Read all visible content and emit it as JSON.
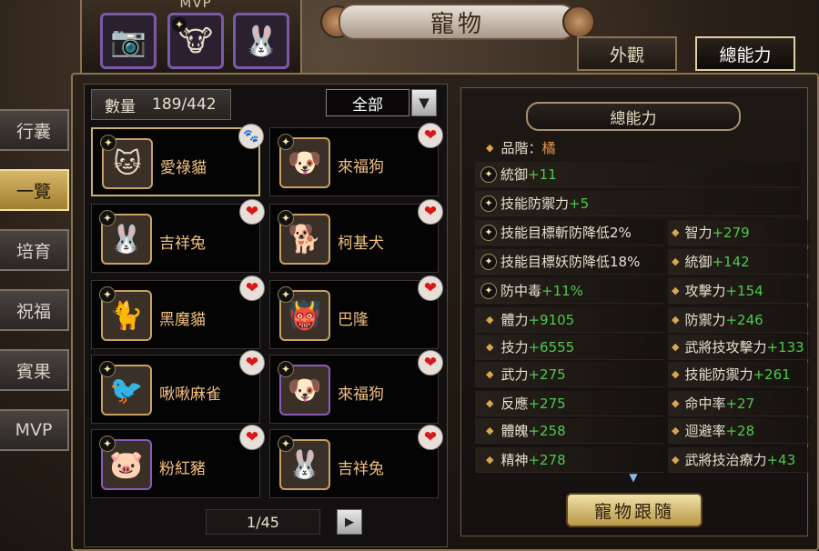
{
  "mvp": {
    "label": "MVP",
    "slots": [
      {
        "icon": "camera-pet-icon",
        "glyph": "📷"
      },
      {
        "icon": "bull-pet-icon",
        "glyph": "🐮"
      },
      {
        "icon": "rabbit-pet-icon",
        "glyph": "🐰"
      }
    ]
  },
  "title": "寵物",
  "top_tabs": [
    {
      "label": "外觀",
      "active": false
    },
    {
      "label": "總能力",
      "active": true
    }
  ],
  "nav": [
    {
      "label": "行囊",
      "active": false
    },
    {
      "label": "一覽",
      "active": true
    },
    {
      "label": "培育",
      "active": false
    },
    {
      "label": "祝福",
      "active": false
    },
    {
      "label": "賓果",
      "active": false
    },
    {
      "label": "MVP",
      "active": false
    }
  ],
  "list": {
    "count_label": "數量",
    "count_value": "189/442",
    "filter": "全部",
    "page": "1/45",
    "pets": [
      {
        "name": "愛祿貓",
        "glyph": "🐱",
        "badge": "paw",
        "selected": true,
        "frame": "gold"
      },
      {
        "name": "來福狗",
        "glyph": "🐶",
        "badge": "heart",
        "selected": false,
        "frame": "gold"
      },
      {
        "name": "吉祥兔",
        "glyph": "🐰",
        "badge": "heart",
        "selected": false,
        "frame": "gold"
      },
      {
        "name": "柯基犬",
        "glyph": "🐕",
        "badge": "heart",
        "selected": false,
        "frame": "gold"
      },
      {
        "name": "黑魔貓",
        "glyph": "🐈",
        "badge": "heart",
        "selected": false,
        "frame": "gold"
      },
      {
        "name": "巴隆",
        "glyph": "👹",
        "badge": "heart",
        "selected": false,
        "frame": "gold"
      },
      {
        "name": "啾啾麻雀",
        "glyph": "🐦",
        "badge": "heart",
        "selected": false,
        "frame": "gold"
      },
      {
        "name": "來福狗",
        "glyph": "🐶",
        "badge": "heart",
        "selected": false,
        "frame": "purple"
      },
      {
        "name": "粉紅豬",
        "glyph": "🐷",
        "badge": "heart",
        "selected": false,
        "frame": "purple"
      },
      {
        "name": "吉祥兔",
        "glyph": "🐰",
        "badge": "heart",
        "selected": false,
        "frame": "gold"
      }
    ]
  },
  "stats": {
    "header": "總能力",
    "grade_label": "品階：",
    "grade_value": "橘",
    "full_rows": [
      {
        "label": "統御",
        "value": "+11"
      },
      {
        "label": "技能防禦力",
        "value": "+5"
      }
    ],
    "left_col": [
      {
        "label": "技能目標斬防降低2%",
        "value": "",
        "icon": "star"
      },
      {
        "label": "技能目標妖防降低18%",
        "value": "",
        "icon": "star"
      },
      {
        "label": "防中毒",
        "value": "+11%",
        "icon": "star"
      },
      {
        "label": "體力",
        "value": "+9105",
        "icon": "diamond"
      },
      {
        "label": "技力",
        "value": "+6555",
        "icon": "diamond"
      },
      {
        "label": "武力",
        "value": "+275",
        "icon": "diamond"
      },
      {
        "label": "反應",
        "value": "+275",
        "icon": "diamond"
      },
      {
        "label": "體魄",
        "value": "+258",
        "icon": "diamond"
      },
      {
        "label": "精神",
        "value": "+278",
        "icon": "diamond"
      }
    ],
    "right_col": [
      {
        "label": "智力",
        "value": "+279"
      },
      {
        "label": "統御",
        "value": "+142"
      },
      {
        "label": "攻擊力",
        "value": "+154"
      },
      {
        "label": "防禦力",
        "value": "+246"
      },
      {
        "label": "武將技攻擊力",
        "value": "+133"
      },
      {
        "label": "技能防禦力",
        "value": "+261"
      },
      {
        "label": "命中率",
        "value": "+27"
      },
      {
        "label": "迴避率",
        "value": "+28"
      },
      {
        "label": "武將技治療力",
        "value": "+43"
      }
    ],
    "follow_button": "寵物跟隨"
  },
  "colors": {
    "frame_gold": "#8a7450",
    "stat_green": "#4ec84e",
    "grade_orange": "#e89850",
    "pet_name": "#f0c080",
    "heart_red": "#d81818"
  }
}
